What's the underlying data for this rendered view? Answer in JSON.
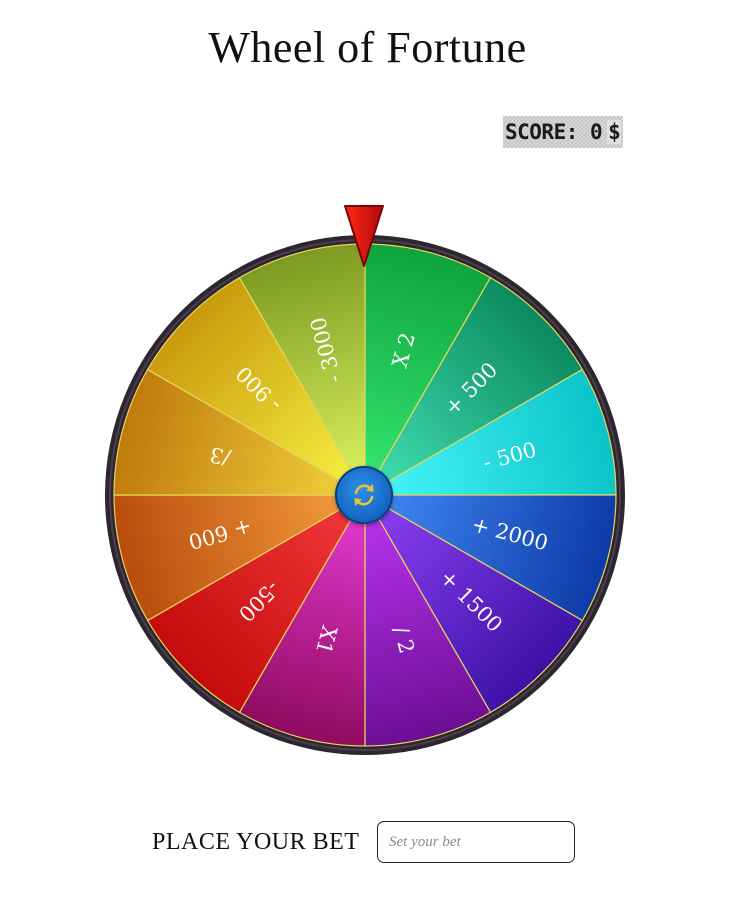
{
  "header": {
    "title": "Wheel of Fortune"
  },
  "score": {
    "label": "SCORE: 0",
    "currency": "$"
  },
  "wheel": {
    "segments": [
      {
        "label": "X 2",
        "color_light": "#34e36f",
        "color_dark": "#0ea33d"
      },
      {
        "label": "+ 500",
        "color_light": "#3fdcb0",
        "color_dark": "#0b8a5e"
      },
      {
        "label": "- 500",
        "color_light": "#45f4f4",
        "color_dark": "#0bc4c8"
      },
      {
        "label": "+ 2000",
        "color_light": "#3f86f2",
        "color_dark": "#0d3aa6"
      },
      {
        "label": "+ 1500",
        "color_light": "#8a3ef0",
        "color_dark": "#3b12a6"
      },
      {
        "label": "/ 2",
        "color_light": "#b733ee",
        "color_dark": "#6b0e92"
      },
      {
        "label": "X1",
        "color_light": "#e238d0",
        "color_dark": "#8f0a5e"
      },
      {
        "label": "-500",
        "color_light": "#f2373a",
        "color_dark": "#c40a0a"
      },
      {
        "label": "+ 600",
        "color_light": "#f29a3c",
        "color_dark": "#b84c0c"
      },
      {
        "label": "/3",
        "color_light": "#f0cf3a",
        "color_dark": "#bf7a0c"
      },
      {
        "label": "- 900",
        "color_light": "#f4ee40",
        "color_dark": "#c99a0c"
      },
      {
        "label": "- 3000",
        "color_light": "#d8ee5c",
        "color_dark": "#7c9a22"
      }
    ],
    "rim_color": "#2d2630",
    "divider_color": "#e8d65a",
    "pointer_color": "#d40f0f",
    "spin_icon": "refresh-icon"
  },
  "bet": {
    "label": "PLACE YOUR BET",
    "input_value": "",
    "input_placeholder": "Set your bet"
  }
}
